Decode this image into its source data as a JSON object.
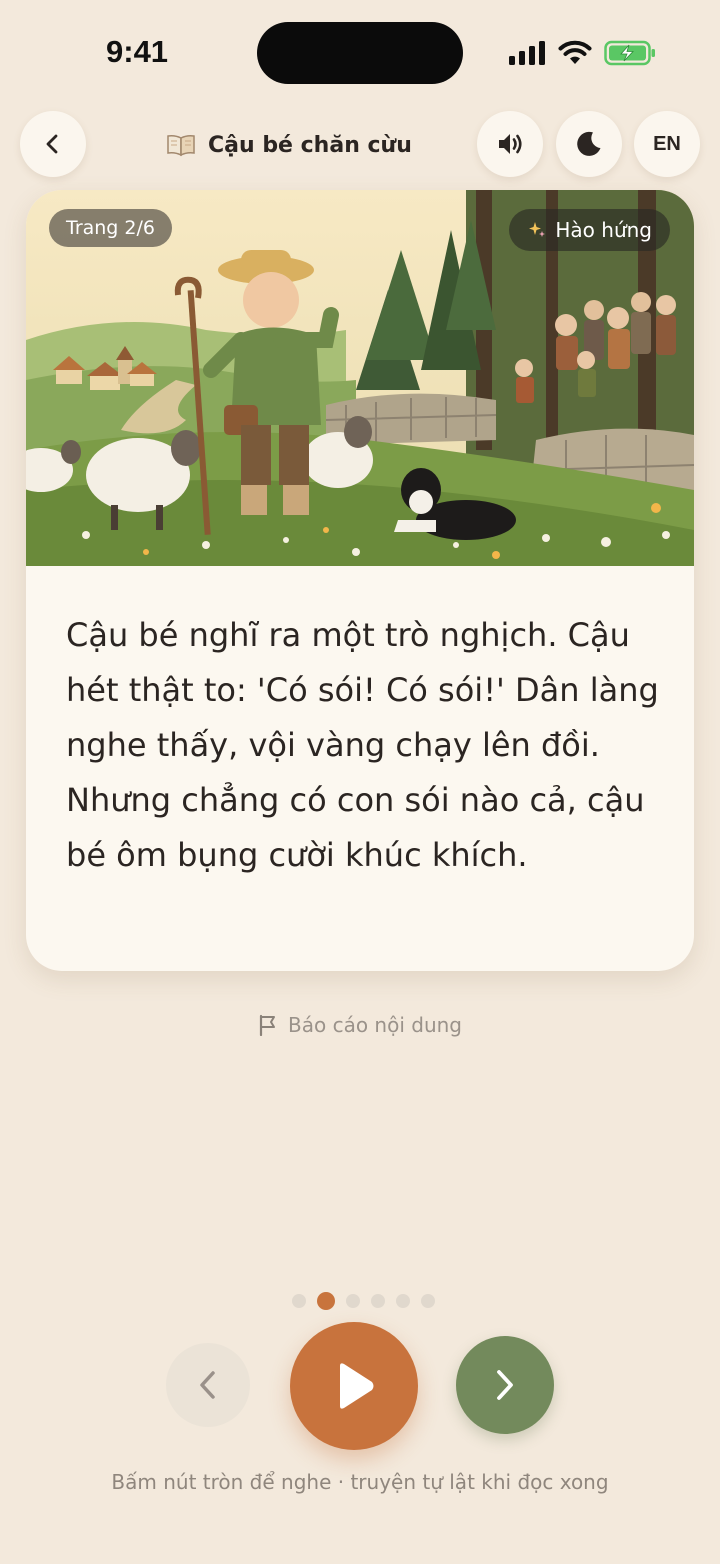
{
  "status_bar": {
    "time": "9:41"
  },
  "header": {
    "title": "Cậu bé chăn cừu",
    "language": "EN",
    "icons": {
      "back": "chevron-left-icon",
      "book": "book-icon",
      "sound": "speaker-icon",
      "night": "moon-icon"
    }
  },
  "card": {
    "page_label": "Trang 2/6",
    "mood_label": "Hào hứng",
    "text": "Cậu bé nghĩ ra một trò nghịch. Cậu hét thật to: 'Có sói! Có sói!' Dân làng nghe thấy, vội vàng chạy lên đồi. Nhưng chẳng có con sói nào cả, cậu bé ôm bụng cười khúc khích."
  },
  "report": {
    "label": "Báo cáo nội dung"
  },
  "pager": {
    "current": 2,
    "total": 6
  },
  "controls": {
    "prev": "chevron-left-icon",
    "play": "play-icon",
    "next": "chevron-right-icon"
  },
  "hint": "Bấm nút tròn để nghe · truyện tự lật khi đọc xong",
  "colors": {
    "background": "#f3e9dc",
    "card": "#fcf8f0",
    "accent": "#c8733d",
    "next": "#738a5c",
    "text": "#2b2522"
  }
}
